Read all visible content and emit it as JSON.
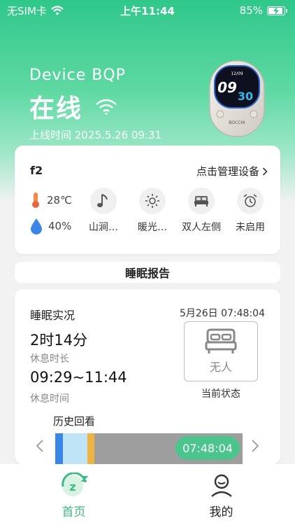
{
  "statusbar": {
    "carrier": "无SIM卡",
    "time": "上午11:44",
    "battery_text": "85%",
    "battery_level": 0.85
  },
  "device": {
    "name": "Device BQP",
    "status": "在线",
    "online_since": "上线时间 2025.5.26 09:31",
    "screen_date": "12/09",
    "screen_hour": "09",
    "screen_minute": "30",
    "brand": "BOCCHI"
  },
  "device_card": {
    "title": "f2",
    "manage_link": "点击管理设备",
    "temperature": "28℃",
    "humidity": "40%",
    "modes": [
      {
        "icon": "music-note-icon",
        "label": "山涧…"
      },
      {
        "icon": "sun-icon",
        "label": "暖光…"
      },
      {
        "icon": "bed-icon",
        "label": "双人左侧"
      },
      {
        "icon": "alarm-clock-icon",
        "label": "未启用"
      }
    ]
  },
  "report_bar": {
    "label": "睡眠报告"
  },
  "sleep": {
    "title": "睡眠实况",
    "datetime": "5月26日 07:48:04",
    "duration": "2时14分",
    "duration_label": "休息时长",
    "range": "09:29~11:44",
    "range_label": "休息时间",
    "state": "无人",
    "state_label": "当前状态",
    "history_label": "历史回看",
    "current_time": "07:48:04",
    "timeline_segments": [
      {
        "color": "#3a86e6",
        "fraction": 0.04
      },
      {
        "color": "#bfe3f7",
        "fraction": 0.13
      },
      {
        "color": "#f0b341",
        "fraction": 0.04
      },
      {
        "color": "#9e9e9e",
        "fraction": 0.79
      }
    ]
  },
  "tabbar": {
    "home": "首页",
    "mine": "我的"
  },
  "colors": {
    "accent": "#3cbc82",
    "hero": "#2fc78a"
  }
}
